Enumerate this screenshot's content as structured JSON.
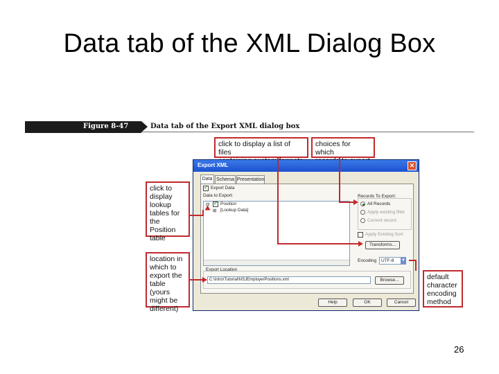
{
  "slide": {
    "title": "Data tab of the XML Dialog Box",
    "page_number": "26"
  },
  "figure": {
    "number": "Figure 8-47",
    "caption": "Data tab of the Export XML dialog box"
  },
  "callouts": {
    "lookup": [
      "click to",
      "display",
      "lookup",
      "tables for",
      "the Position",
      "table"
    ],
    "location": [
      "location in",
      "which to",
      "export the",
      "table (yours",
      "might be",
      "different)"
    ],
    "files": [
      "click to display a list of files",
      "containing custom formats"
    ],
    "records": [
      "choices for which",
      "records to export"
    ],
    "encoding": [
      "default",
      "character",
      "encoding",
      "method"
    ]
  },
  "dialog": {
    "title": "Export XML",
    "close_glyph": "✕",
    "tabs": [
      "Data",
      "Schema",
      "Presentation"
    ],
    "export_data_label": "Export Data",
    "export_data_checked": true,
    "data_to_export_label": "Data to Export:",
    "tree": [
      {
        "expander": "⊟",
        "checked": true,
        "label": "Position"
      },
      {
        "expander": "⊞",
        "checked": false,
        "label": "[Lookup Data]"
      }
    ],
    "records_label": "Records To Export:",
    "records_options": [
      {
        "label": "All Records",
        "selected": true
      },
      {
        "label": "Apply existing filter",
        "selected": false
      },
      {
        "label": "Current record",
        "selected": false
      }
    ],
    "apply_sort_label": "Apply Existing Sort",
    "transforms_button": "Transforms...",
    "encoding_label": "Encoding",
    "encoding_value": "UTF-8",
    "encoding_arrow": "▼",
    "export_location_label": "Export Location",
    "export_path": "C:\\Intro\\Tutorial\\NSJEmployerPositions.xml",
    "browse_button": "Browse...",
    "help_button": "Help",
    "ok_button": "OK",
    "cancel_button": "Cancel"
  },
  "colors": {
    "callout_border": "#c0292d",
    "figure_bar": "#1c1c1c",
    "titlebar": "#1c52d1"
  }
}
